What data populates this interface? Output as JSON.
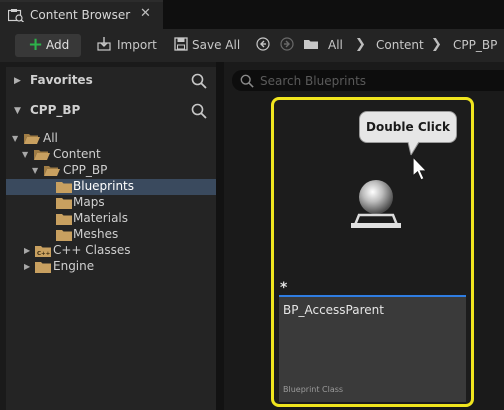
{
  "window": {
    "tab_title": "Content Browser",
    "close_glyph": "✕"
  },
  "toolbar": {
    "add_label": "Add",
    "import_label": "Import",
    "save_all_label": "Save All",
    "breadcrumb": [
      "All",
      "Content",
      "CPP_BP"
    ],
    "separator": "❯"
  },
  "sources": {
    "favorites_label": "Favorites",
    "project_label": "CPP_BP",
    "tree": [
      {
        "label": "All",
        "depth": 0,
        "expanded": true,
        "selected": false
      },
      {
        "label": "Content",
        "depth": 1,
        "expanded": true,
        "selected": false
      },
      {
        "label": "CPP_BP",
        "depth": 2,
        "expanded": true,
        "selected": false
      },
      {
        "label": "Blueprints",
        "depth": 3,
        "expanded": false,
        "selected": true
      },
      {
        "label": "Maps",
        "depth": 3,
        "expanded": false,
        "selected": false
      },
      {
        "label": "Materials",
        "depth": 3,
        "expanded": false,
        "selected": false
      },
      {
        "label": "Meshes",
        "depth": 3,
        "expanded": false,
        "selected": false
      },
      {
        "label": "C++ Classes",
        "depth": 1,
        "expanded": false,
        "selected": false
      },
      {
        "label": "Engine",
        "depth": 1,
        "expanded": false,
        "selected": false
      }
    ]
  },
  "search": {
    "placeholder": "Search Blueprints"
  },
  "asset": {
    "name": "BP_AccessParent",
    "type": "Blueprint Class",
    "modified_marker": "*",
    "callout": "Double Click"
  },
  "colors": {
    "highlight": "#f0e51e",
    "add_plus": "#2db34a",
    "selection": "#3a4a5e",
    "folder": "#c8a060",
    "accent_line": "#2f7de1"
  },
  "icons": {
    "tab": "content-browser-icon",
    "import": "import-icon",
    "save_all": "save-all-icon",
    "back": "back-arrow-icon",
    "forward": "forward-arrow-icon",
    "path_folder": "folder-icon",
    "search": "search-icon",
    "asset": "blueprint-sphere-icon",
    "cursor": "mouse-cursor-icon"
  }
}
